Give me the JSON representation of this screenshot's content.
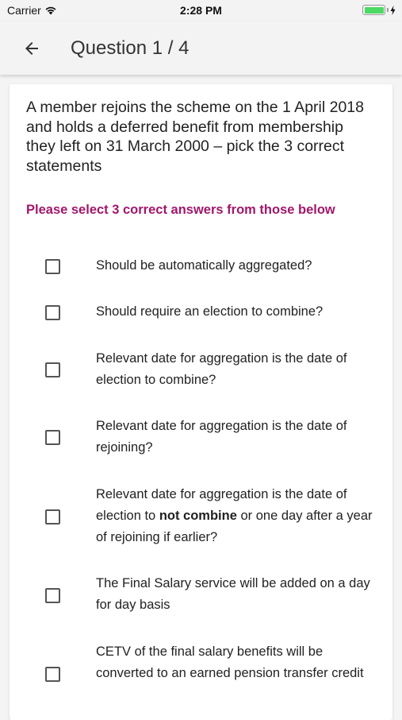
{
  "status_bar": {
    "carrier": "Carrier",
    "time": "2:28 PM",
    "battery_level": 1.0
  },
  "header": {
    "title": "Question 1 / 4",
    "back_icon": "arrow-left-icon"
  },
  "question": {
    "text": "A member rejoins the scheme on the 1 April 2018 and holds a deferred benefit from membership they left on 31 March 2000 – pick the 3 correct statements",
    "instruction": "Please select 3 correct answers from those below",
    "instruction_color": "#a2176a"
  },
  "options": [
    {
      "text": "Should be automatically aggregated?",
      "checked": false
    },
    {
      "text": "Should require an election to combine?",
      "checked": false
    },
    {
      "text": "Relevant date for aggregation is the date of election to combine?",
      "checked": false
    },
    {
      "text": "Relevant date for aggregation is the date of rejoining?",
      "checked": false
    },
    {
      "text_before": "Relevant date for aggregation is the date of election to ",
      "text_bold": "not combine",
      "text_after": " or one day after a year of rejoining if earlier?",
      "checked": false
    },
    {
      "text": "The Final Salary service will be added on a day for day basis",
      "checked": false
    },
    {
      "text": "CETV of the final salary benefits will be converted to an earned pension transfer credit",
      "checked": false
    }
  ]
}
